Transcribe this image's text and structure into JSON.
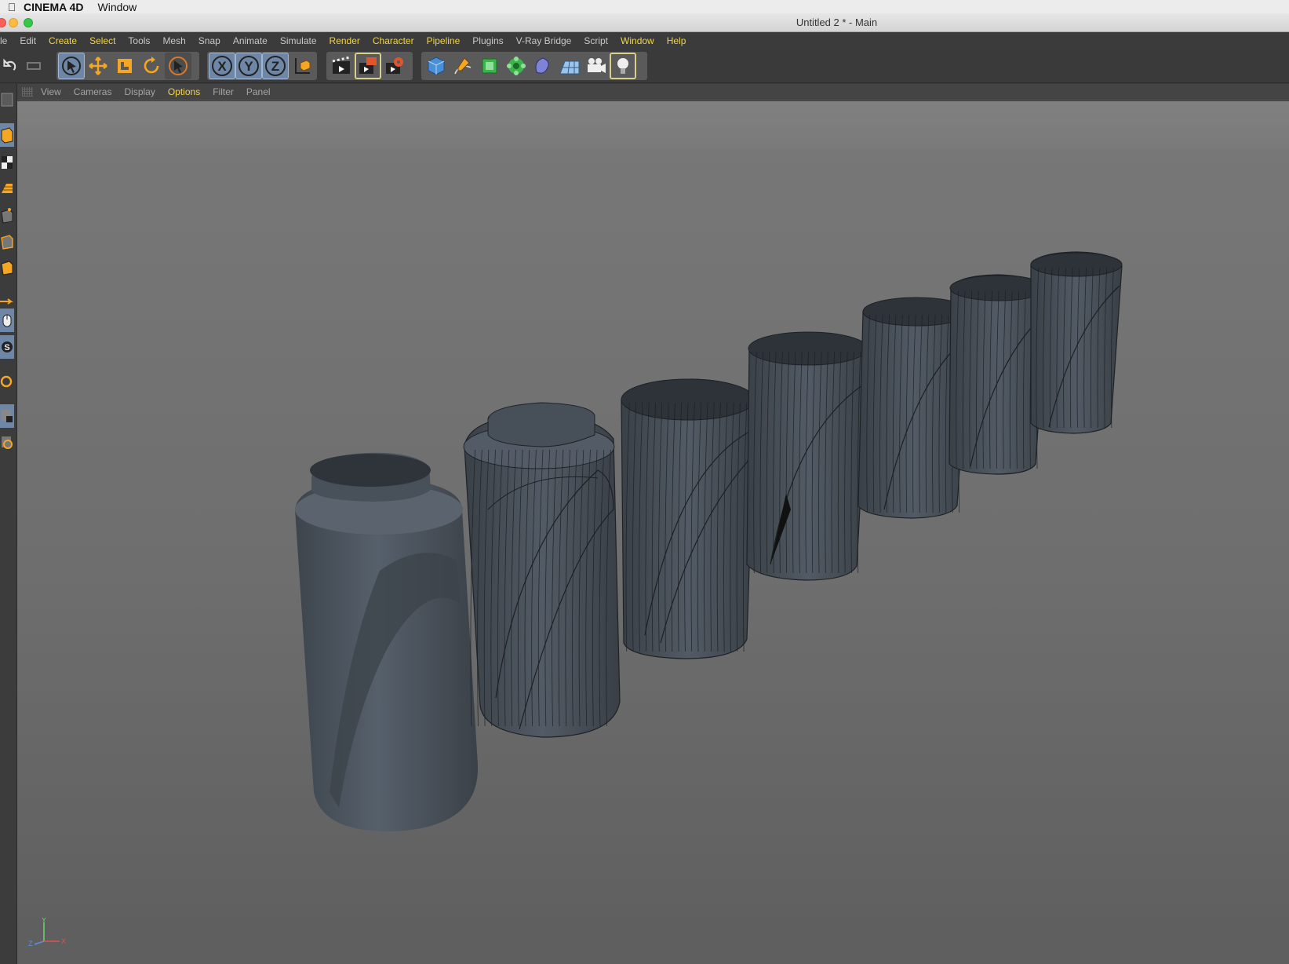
{
  "mac_menubar": {
    "app_name": "CINEMA 4D",
    "menus": [
      "Window"
    ]
  },
  "window": {
    "title": "Untitled 2 * - Main"
  },
  "menubar": {
    "items": [
      {
        "label": "le",
        "highlight": false
      },
      {
        "label": "Edit",
        "highlight": false
      },
      {
        "label": "Create",
        "highlight": true
      },
      {
        "label": "Select",
        "highlight": true
      },
      {
        "label": "Tools",
        "highlight": false
      },
      {
        "label": "Mesh",
        "highlight": false
      },
      {
        "label": "Snap",
        "highlight": false
      },
      {
        "label": "Animate",
        "highlight": false
      },
      {
        "label": "Simulate",
        "highlight": false
      },
      {
        "label": "Render",
        "highlight": true
      },
      {
        "label": "Character",
        "highlight": true
      },
      {
        "label": "Pipeline",
        "highlight": true
      },
      {
        "label": "Plugins",
        "highlight": false
      },
      {
        "label": "V-Ray Bridge",
        "highlight": false
      },
      {
        "label": "Script",
        "highlight": false
      },
      {
        "label": "Window",
        "highlight": true
      },
      {
        "label": "Help",
        "highlight": true
      }
    ]
  },
  "toolbar": {
    "axis_x": "X",
    "axis_y": "Y",
    "axis_z": "Z",
    "icons": [
      "undo-icon",
      "redo-icon",
      "live-selection-icon",
      "move-icon",
      "scale-icon",
      "rotate-icon",
      "last-tool-icon",
      "x-axis-icon",
      "y-axis-icon",
      "z-axis-icon",
      "coordinate-system-icon",
      "render-view-icon",
      "render-picture-viewer-icon",
      "render-settings-icon",
      "cube-icon",
      "pen-spline-icon",
      "subdivision-icon",
      "array-icon",
      "deformer-icon",
      "floor-icon",
      "camera-icon",
      "light-icon"
    ]
  },
  "viewport_menu": {
    "items": [
      {
        "label": "View",
        "highlight": false
      },
      {
        "label": "Cameras",
        "highlight": false
      },
      {
        "label": "Display",
        "highlight": false
      },
      {
        "label": "Options",
        "highlight": true
      },
      {
        "label": "Filter",
        "highlight": false
      },
      {
        "label": "Panel",
        "highlight": false
      }
    ]
  },
  "axis_gizmo": {
    "x": "X",
    "y": "Y",
    "z": "Z"
  },
  "colors": {
    "accent_yellow": "#f0d44a",
    "active_blue": "#6f87a6",
    "icon_orange": "#f5a623",
    "object_gray": "#4a525c"
  }
}
